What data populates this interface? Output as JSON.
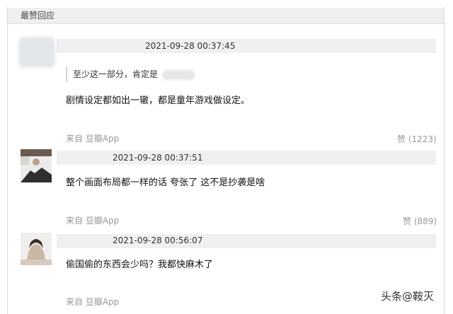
{
  "section": {
    "title": "最赞回应"
  },
  "comments": [
    {
      "timestamp": "2021-09-28 00:37:45",
      "quote": "至少这一部分，肯定是",
      "text": "剧情设定都如出一辙，都是童年游戏做设定。",
      "source": "来自 豆瓣App",
      "likes": "赞 (1223)"
    },
    {
      "timestamp": "2021-09-28 00:37:51",
      "text": "整个画面布局都一样的话 夸张了 这不是抄袭是啥",
      "source": "来自 豆瓣App",
      "likes": "赞 (889)"
    },
    {
      "timestamp": "2021-09-28 00:56:07",
      "text": "偷国偷的东西会少吗？我都快麻木了",
      "source": "来自 豆瓣App"
    }
  ],
  "watermark": "头条@鞍灭"
}
